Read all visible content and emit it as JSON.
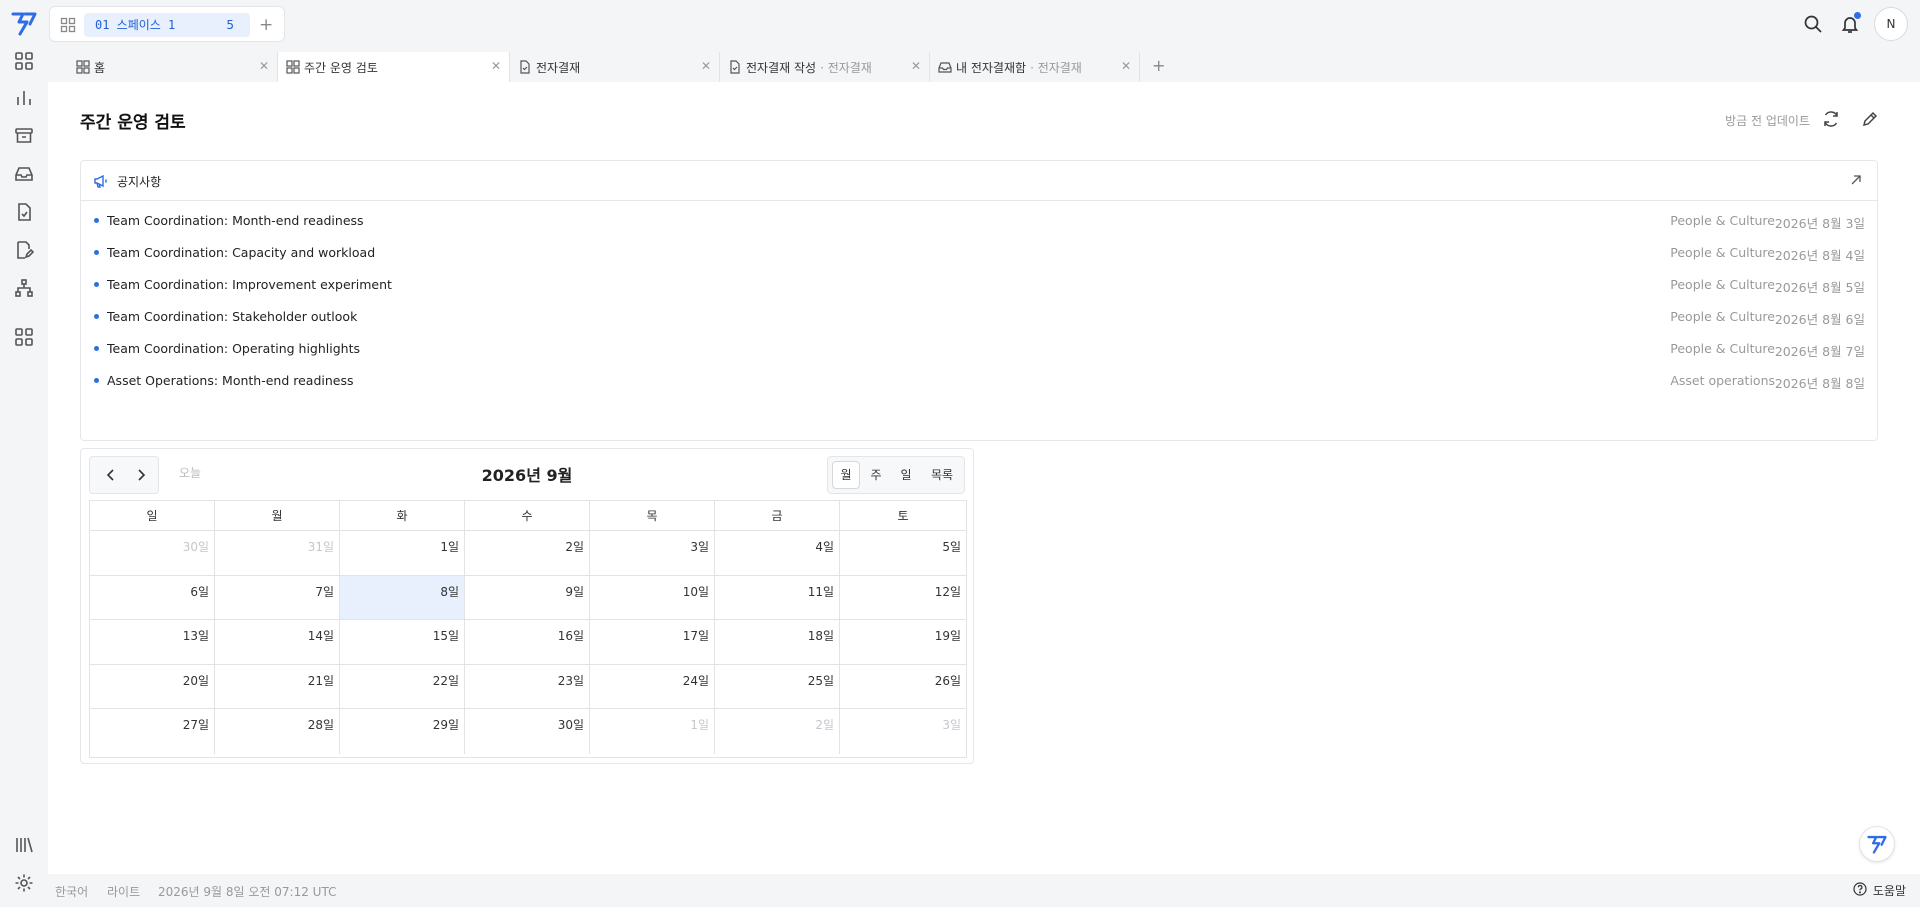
{
  "space": {
    "name": "01 스페이스 1",
    "count": "5"
  },
  "user": {
    "avatar_initial": "N"
  },
  "tabs": [
    {
      "label": "홈",
      "sub": ""
    },
    {
      "label": "주간 운영 검토",
      "sub": ""
    },
    {
      "label": "전자결재",
      "sub": ""
    },
    {
      "label": "전자결재 작성",
      "sub": "· 전자결재"
    },
    {
      "label": "내 전자결재함",
      "sub": "· 전자결재"
    }
  ],
  "page": {
    "title": "주간 운영 검토",
    "update_label": "방금 전 업데이트"
  },
  "notice": {
    "title": "공지사항",
    "items": [
      {
        "title": "Team Coordination: Month-end readiness",
        "dept": "People & Culture",
        "date": "2026년 8월 3일"
      },
      {
        "title": "Team Coordination: Capacity and workload",
        "dept": "People & Culture",
        "date": "2026년 8월 4일"
      },
      {
        "title": "Team Coordination: Improvement experiment",
        "dept": "People & Culture",
        "date": "2026년 8월 5일"
      },
      {
        "title": "Team Coordination: Stakeholder outlook",
        "dept": "People & Culture",
        "date": "2026년 8월 6일"
      },
      {
        "title": "Team Coordination: Operating highlights",
        "dept": "People & Culture",
        "date": "2026년 8월 7일"
      },
      {
        "title": "Asset Operations: Month-end readiness",
        "dept": "Asset operations",
        "date": "2026년 8월 8일"
      }
    ]
  },
  "calendar": {
    "today_label": "오늘",
    "title": "2026년 9월",
    "views": [
      "월",
      "주",
      "일",
      "목록"
    ],
    "active_view": "월",
    "weekdays": [
      "일",
      "월",
      "화",
      "수",
      "목",
      "금",
      "토"
    ],
    "weeks": [
      [
        {
          "d": "30일",
          "o": true
        },
        {
          "d": "31일",
          "o": true
        },
        {
          "d": "1일"
        },
        {
          "d": "2일"
        },
        {
          "d": "3일"
        },
        {
          "d": "4일"
        },
        {
          "d": "5일"
        }
      ],
      [
        {
          "d": "6일"
        },
        {
          "d": "7일"
        },
        {
          "d": "8일",
          "t": true
        },
        {
          "d": "9일"
        },
        {
          "d": "10일"
        },
        {
          "d": "11일"
        },
        {
          "d": "12일"
        }
      ],
      [
        {
          "d": "13일"
        },
        {
          "d": "14일"
        },
        {
          "d": "15일"
        },
        {
          "d": "16일"
        },
        {
          "d": "17일"
        },
        {
          "d": "18일"
        },
        {
          "d": "19일"
        }
      ],
      [
        {
          "d": "20일"
        },
        {
          "d": "21일"
        },
        {
          "d": "22일"
        },
        {
          "d": "23일"
        },
        {
          "d": "24일"
        },
        {
          "d": "25일"
        },
        {
          "d": "26일"
        }
      ],
      [
        {
          "d": "27일"
        },
        {
          "d": "28일"
        },
        {
          "d": "29일"
        },
        {
          "d": "30일"
        },
        {
          "d": "1일",
          "o": true
        },
        {
          "d": "2일",
          "o": true
        },
        {
          "d": "3일",
          "o": true
        }
      ]
    ]
  },
  "footer": {
    "language": "한국어",
    "theme": "라이트",
    "datetime": "2026년 9월 8일 오전 07:12 UTC",
    "help": "도움말"
  },
  "colors": {
    "accent": "#2f6de6",
    "today_bg": "#e8f0fd"
  }
}
